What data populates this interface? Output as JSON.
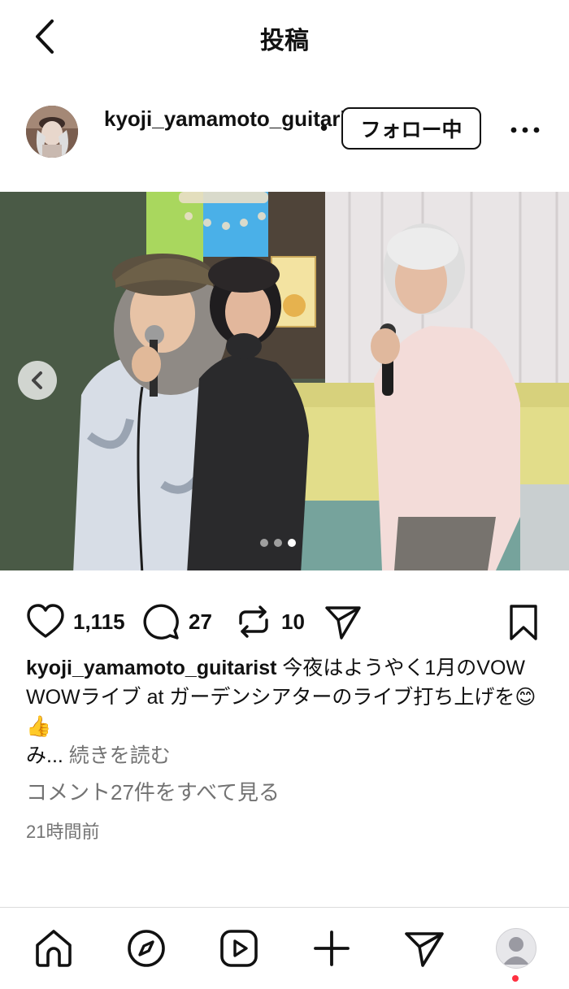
{
  "header": {
    "title": "投稿",
    "back_icon": "chevron-left-icon"
  },
  "post": {
    "username": "kyoji_yamamoto_guitarist",
    "separator": "•",
    "follow_label": "フォロー中",
    "more_icon": "ellipsis-icon",
    "carousel": {
      "total": 3,
      "active_index": 2
    },
    "likes": "1,115",
    "comments": "27",
    "reposts": "10",
    "caption_username": "kyoji_yamamoto_guitarist",
    "caption_text": " 今夜はようやく1月のVOW WOWライブ at ガーデンシアターのライブ打ち上げを😊 👍",
    "caption_cont": "み...",
    "read_more": "続きを読む",
    "view_comments": "コメント27件をすべて見る",
    "time": "21時間前"
  },
  "colors": {
    "text": "#111111",
    "muted": "#737373",
    "notification": "#ff3040",
    "divider": "#dbdbdb"
  },
  "tabbar": {
    "items": [
      "home-icon",
      "explore-icon",
      "reels-icon",
      "create-icon",
      "messages-icon",
      "profile-icon"
    ]
  }
}
